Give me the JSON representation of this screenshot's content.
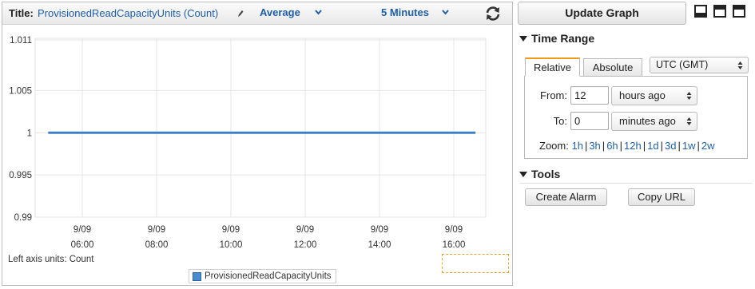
{
  "graph": {
    "title_label": "Title:",
    "title_value": "ProvisionedReadCapacityUnits (Count)",
    "statistic": "Average",
    "period": "5 Minutes",
    "left_axis_units_label": "Left axis units:",
    "left_axis_units_value": "Count",
    "legend_label": "ProvisionedReadCapacityUnits"
  },
  "chart_data": {
    "type": "line",
    "y_ticks": [
      "1.011",
      "1.005",
      "1",
      "0.995",
      "0.99"
    ],
    "ylim": [
      0.99,
      1.011
    ],
    "x_ticks": [
      {
        "date": "9/09",
        "time": "06:00"
      },
      {
        "date": "9/09",
        "time": "08:00"
      },
      {
        "date": "9/09",
        "time": "10:00"
      },
      {
        "date": "9/09",
        "time": "12:00"
      },
      {
        "date": "9/09",
        "time": "14:00"
      },
      {
        "date": "9/09",
        "time": "16:00"
      }
    ],
    "series": [
      {
        "name": "ProvisionedReadCapacityUnits",
        "color": "#4a8bd0",
        "x": [
          "05:05",
          "16:35"
        ],
        "values": [
          1,
          1
        ]
      }
    ],
    "grid": true
  },
  "controls": {
    "update_graph": "Update Graph",
    "time_range_heading": "Time Range",
    "tab_relative": "Relative",
    "tab_absolute": "Absolute",
    "timezone": "UTC (GMT)",
    "from_label": "From:",
    "from_value": "12",
    "from_unit": "hours ago",
    "to_label": "To:",
    "to_value": "0",
    "to_unit": "minutes ago",
    "zoom_label": "Zoom:",
    "zoom_options": [
      "1h",
      "3h",
      "6h",
      "12h",
      "1d",
      "3d",
      "1w",
      "2w"
    ],
    "tools_heading": "Tools",
    "create_alarm": "Create Alarm",
    "copy_url": "Copy URL"
  },
  "colors": {
    "accent_link": "#1f5fa8",
    "active_tab": "#f29a1c",
    "series": "#4a8bd0"
  }
}
